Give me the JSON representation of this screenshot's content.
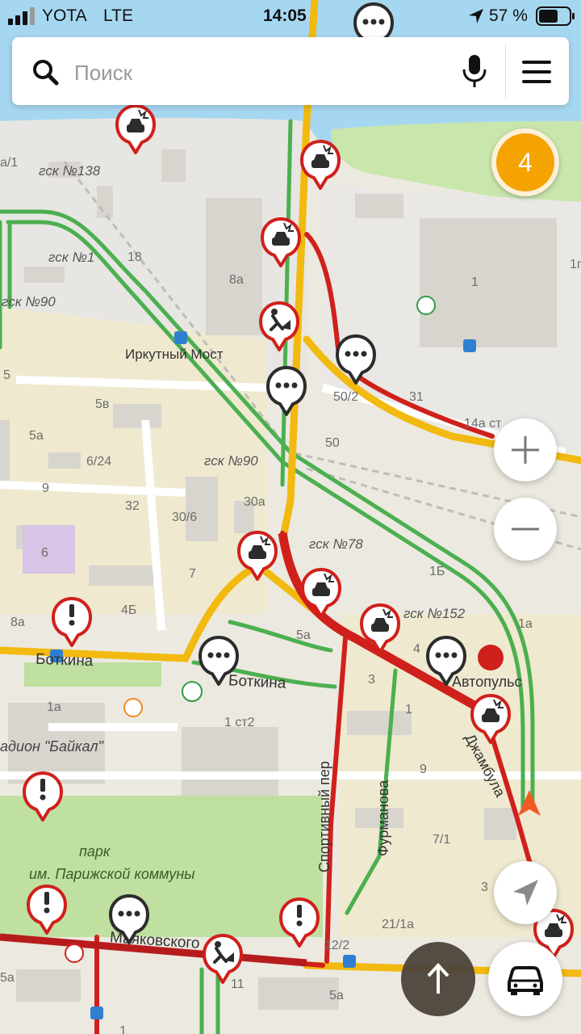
{
  "status_bar": {
    "carrier": "YOTA",
    "network": "LTE",
    "time": "14:05",
    "battery": "57 %"
  },
  "search": {
    "placeholder": "Поиск"
  },
  "cluster": {
    "count": "4"
  },
  "streets": {
    "botkina_1": "Боткина",
    "botkina_2": "Боткина",
    "sportivny": "Спортивный пер",
    "furmanova": "Фурманова",
    "dzhambula": "Джамбула",
    "mayakovskogo": "Маяковского"
  },
  "places": {
    "stop_irkutny_most": "Иркутный Мост",
    "autopuls": "Автопульс",
    "stadium": "адион \"Байкал\"",
    "park_line1": "парк",
    "park_line2": "им. Парижской коммуны"
  },
  "areas": {
    "gsk138": "гск №138",
    "gsk1": "гск №1",
    "gsk90a": "гск №90",
    "gsk90b": "гск №90",
    "gsk78": "гск №78",
    "gsk152": "гск №152"
  },
  "house_numbers": {
    "n_a1": "а/1",
    "n_18": "18",
    "n_8a_top": "8а",
    "n_1": "1",
    "n_1r": "1г",
    "n_5": "5",
    "n_5v": "5в",
    "n_5a_l": "5а",
    "n_6_24": "6/24",
    "n_9": "9",
    "n_32": "32",
    "n_30_6": "30/6",
    "n_6": "6",
    "n_7": "7",
    "n_8a": "8а",
    "n_4b": "4Б",
    "n_50_2": "50/2",
    "n_31": "31",
    "n_14a": "14а ст",
    "n_50": "50",
    "n_30a": "30а",
    "n_1b": "1Б",
    "n_1a_r": "1а",
    "n_5a_mid": "5а",
    "n_4": "4",
    "n_3": "3",
    "n_1_mid": "1",
    "n_1a_l": "1а",
    "n_1st2": "1 ст2",
    "n_9_r": "9",
    "n_7_1": "7/1",
    "n_3_r": "3",
    "n_21_1a": "21/1а",
    "n_12_2": "12/2",
    "n_11": "11",
    "n_5a_bot": "5а",
    "n_5a_bl": "5а",
    "n_1_bot": "1"
  },
  "icons": {
    "accident": "accident-icon",
    "roadworks": "roadworks-icon",
    "chat": "chat-icon",
    "warning": "warning-icon",
    "search": "search-icon",
    "microphone": "microphone-icon",
    "menu": "menu-icon"
  },
  "colors": {
    "traffic_green": "#4caf50",
    "traffic_yellow": "#f2b90f",
    "traffic_red": "#d0201c",
    "water": "#a6d7f1",
    "park": "#bfe0a0",
    "cluster": "#f5a300"
  }
}
